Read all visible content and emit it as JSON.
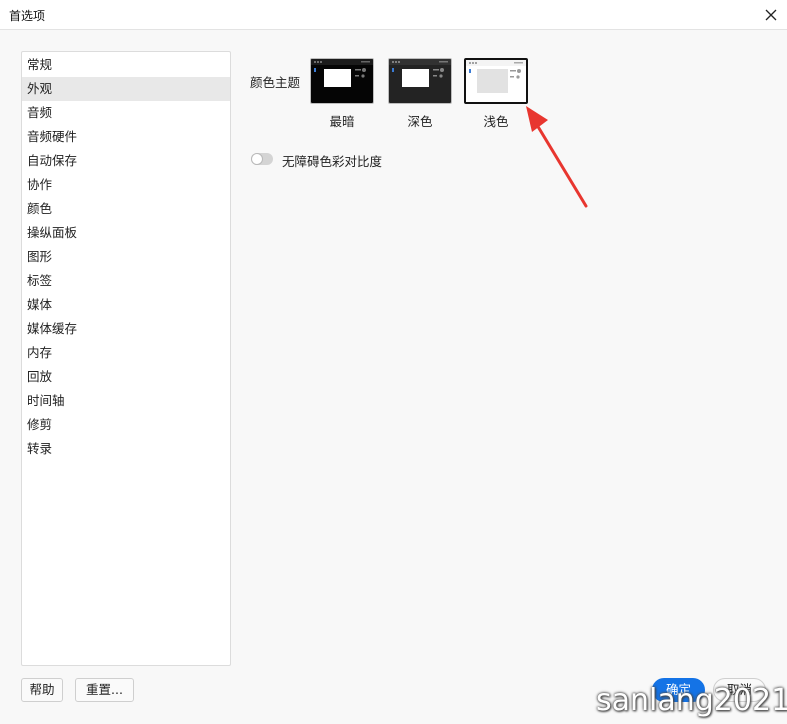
{
  "window": {
    "title": "首选项"
  },
  "sidebar": {
    "items": [
      {
        "label": "常规",
        "active": false
      },
      {
        "label": "外观",
        "active": true
      },
      {
        "label": "音频",
        "active": false
      },
      {
        "label": "音频硬件",
        "active": false
      },
      {
        "label": "自动保存",
        "active": false
      },
      {
        "label": "协作",
        "active": false
      },
      {
        "label": "颜色",
        "active": false
      },
      {
        "label": "操纵面板",
        "active": false
      },
      {
        "label": "图形",
        "active": false
      },
      {
        "label": "标签",
        "active": false
      },
      {
        "label": "媒体",
        "active": false
      },
      {
        "label": "媒体缓存",
        "active": false
      },
      {
        "label": "内存",
        "active": false
      },
      {
        "label": "回放",
        "active": false
      },
      {
        "label": "时间轴",
        "active": false
      },
      {
        "label": "修剪",
        "active": false
      },
      {
        "label": "转录",
        "active": false
      }
    ]
  },
  "appearance": {
    "theme_label": "颜色主题",
    "themes": [
      {
        "label": "最暗",
        "selected": false
      },
      {
        "label": "深色",
        "selected": false
      },
      {
        "label": "浅色",
        "selected": true
      }
    ],
    "accessibility_toggle": {
      "label": "无障碍色彩对比度",
      "on": false
    }
  },
  "footer": {
    "help_label": "帮助",
    "reset_label": "重置...",
    "ok_label": "确定",
    "cancel_label": "取消"
  },
  "watermark": "sanlang2021",
  "colors": {
    "accent": "#1473e6",
    "arrow": "#e8362f"
  }
}
